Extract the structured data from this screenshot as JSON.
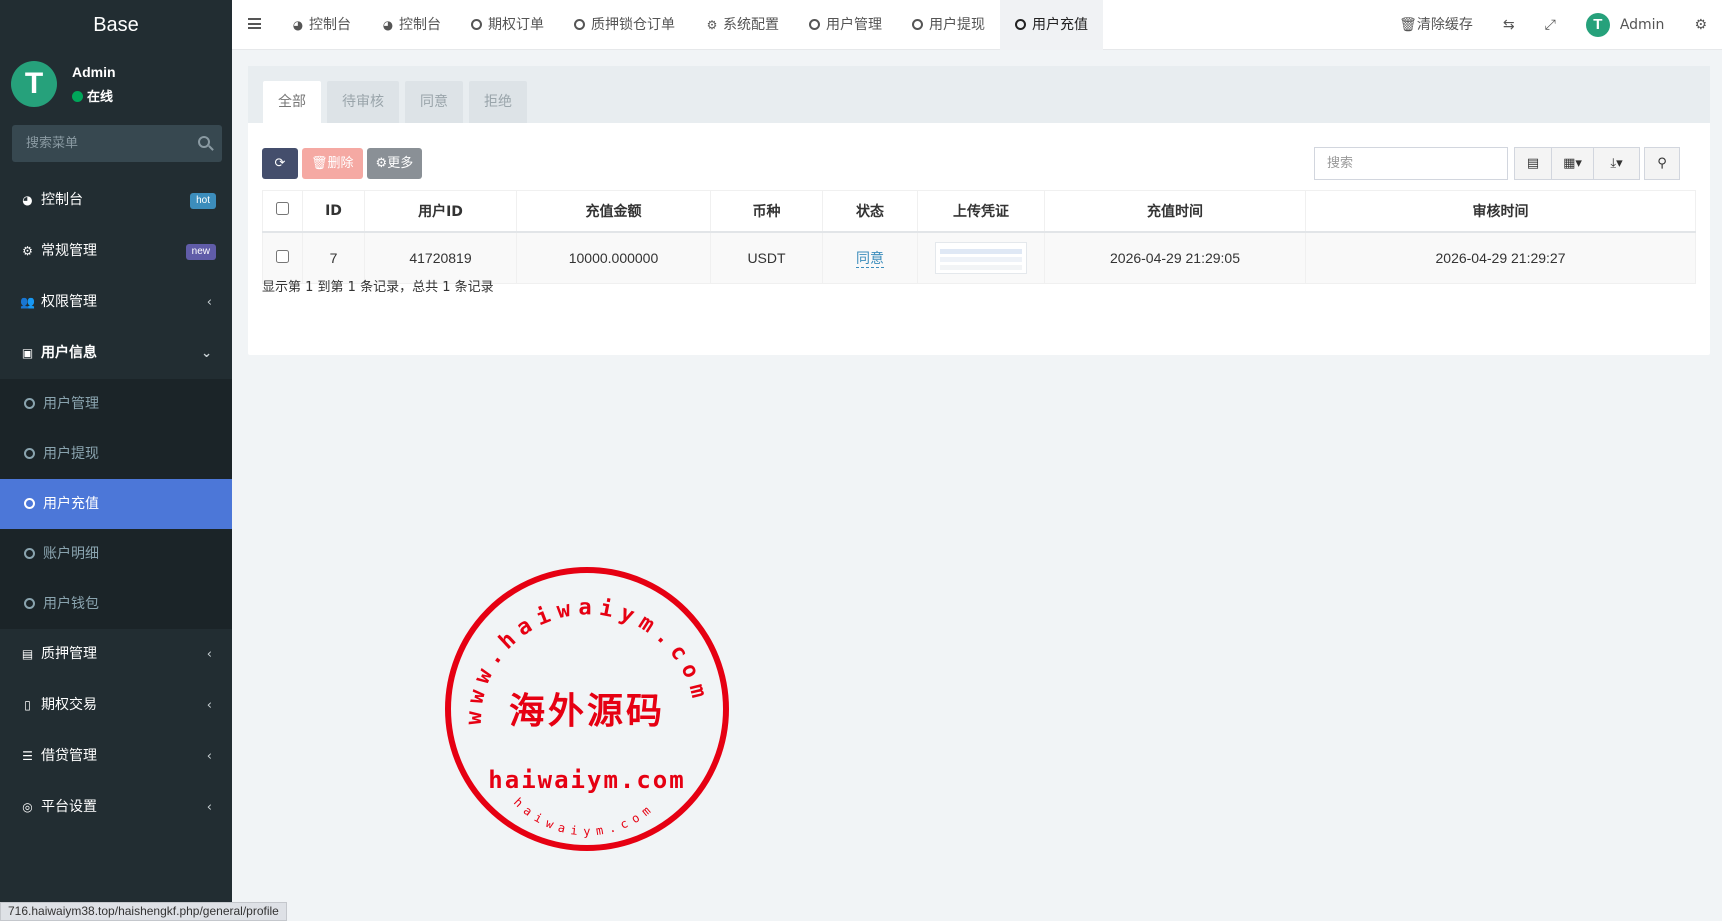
{
  "brand": "Base",
  "user": {
    "name": "Admin",
    "status": "在线",
    "avatar_letter": "T"
  },
  "sidebar": {
    "search_placeholder": "搜索菜单",
    "items": [
      {
        "label": "控制台",
        "icon": "dashboard-icon",
        "badge": "hot"
      },
      {
        "label": "常规管理",
        "icon": "cogs-icon",
        "badge": "new"
      },
      {
        "label": "权限管理",
        "icon": "users-icon",
        "chevron": "‹"
      },
      {
        "label": "用户信息",
        "icon": "address-book-icon",
        "chevron": "⌄"
      }
    ],
    "submenu": [
      {
        "label": "用户管理",
        "icon": "user-circle-icon"
      },
      {
        "label": "用户提现",
        "icon": "circle-icon"
      },
      {
        "label": "用户充值",
        "icon": "circle-icon",
        "active": true
      },
      {
        "label": "账户明细",
        "icon": "circle-icon"
      },
      {
        "label": "用户钱包",
        "icon": "circle-icon"
      }
    ],
    "items_after": [
      {
        "label": "质押管理",
        "icon": "newspaper-icon",
        "chevron": "‹"
      },
      {
        "label": "期权交易",
        "icon": "file-icon",
        "chevron": "‹"
      },
      {
        "label": "借贷管理",
        "icon": "list-icon",
        "chevron": "‹"
      },
      {
        "label": "平台设置",
        "icon": "dot-circle-icon",
        "chevron": "‹"
      }
    ]
  },
  "topbar": {
    "tabs": [
      {
        "label": "控制台",
        "icon": "dashboard-icon"
      },
      {
        "label": "控制台",
        "icon": "dashboard-icon"
      },
      {
        "label": "期权订单",
        "icon": "circle-icon"
      },
      {
        "label": "质押锁仓订单",
        "icon": "circle-icon"
      },
      {
        "label": "系统配置",
        "icon": "cog-icon"
      },
      {
        "label": "用户管理",
        "icon": "user-circle-icon"
      },
      {
        "label": "用户提现",
        "icon": "circle-icon"
      },
      {
        "label": "用户充值",
        "icon": "circle-icon",
        "active": true
      }
    ],
    "clear_cache": "清除缓存",
    "admin_name": "Admin"
  },
  "panel": {
    "tabs": [
      "全部",
      "待审核",
      "同意",
      "拒绝"
    ],
    "active_tab": "全部",
    "buttons": {
      "delete": "删除",
      "more": "更多"
    },
    "search_placeholder": "搜索",
    "columns": [
      "ID",
      "用户ID",
      "充值金额",
      "币种",
      "状态",
      "上传凭证",
      "充值时间",
      "审核时间"
    ],
    "rows": [
      {
        "id": "7",
        "user_id": "41720819",
        "amount": "10000.000000",
        "currency": "USDT",
        "status": "同意",
        "recharge_time": "2026-04-29 21:29:05",
        "review_time": "2026-04-29 21:29:27"
      }
    ],
    "pager_info": "显示第 1 到第 1 条记录，总共 1 条记录"
  },
  "status_url": "716.haiwaiym38.top/haishengkf.php/general/profile",
  "watermark": {
    "outer_text": "www.haiwaiym.com",
    "center_text": "海外源码",
    "domain_text": "haiwaiym.com",
    "bottom_text": "haiwaiym.com",
    "color": "#e60012"
  },
  "colors": {
    "sidebar_bg": "#222d32",
    "active_menu": "#4c77d8",
    "avatar": "#26a17b",
    "hot_badge": "#3c8dbc",
    "new_badge": "#605ca8",
    "delete_button": "#f5a9a3",
    "refresh_button": "#444e6c"
  }
}
